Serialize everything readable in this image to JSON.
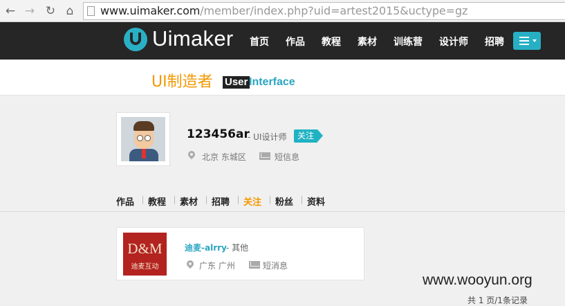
{
  "browser": {
    "url_host": "www.uimaker.com",
    "url_path": "/member/index.php?uid=artest2015&uctype=gz"
  },
  "site_nav": {
    "logo_text": "Uimaker",
    "items": [
      "首页",
      "作品",
      "教程",
      "素材",
      "训练营",
      "设计师",
      "招聘"
    ]
  },
  "tagline": {
    "cn": "UI制造者",
    "user_word": "User",
    "interface_word": "Interface"
  },
  "profile": {
    "username": "123456ar",
    "role": "- UI设计师",
    "follow_label": "关注",
    "location": "北京 东城区",
    "message_label": "短信息"
  },
  "tabs": [
    {
      "label": "作品",
      "active": false
    },
    {
      "label": "教程",
      "active": false
    },
    {
      "label": "素材",
      "active": false
    },
    {
      "label": "招聘",
      "active": false
    },
    {
      "label": "关注",
      "active": true
    },
    {
      "label": "粉丝",
      "active": false
    },
    {
      "label": "资料",
      "active": false
    }
  ],
  "following": [
    {
      "logo_text": "D&M",
      "logo_subtext": "迪麦互动",
      "name": "迪麦-alrry",
      "category": "- 其他",
      "location": "广东 广州",
      "message_label": "短消息"
    }
  ],
  "watermark": "www.wooyun.org",
  "footer_count": "共 1 页/1条记录",
  "colors": {
    "accent_orange": "#f39800",
    "accent_cyan": "#1fb2c3",
    "nav_bg": "#262626"
  },
  "icons": [
    "back-arrow-icon",
    "forward-arrow-icon",
    "reload-icon",
    "home-icon",
    "page-icon",
    "menu-list-icon",
    "location-pin-icon",
    "mail-icon"
  ]
}
